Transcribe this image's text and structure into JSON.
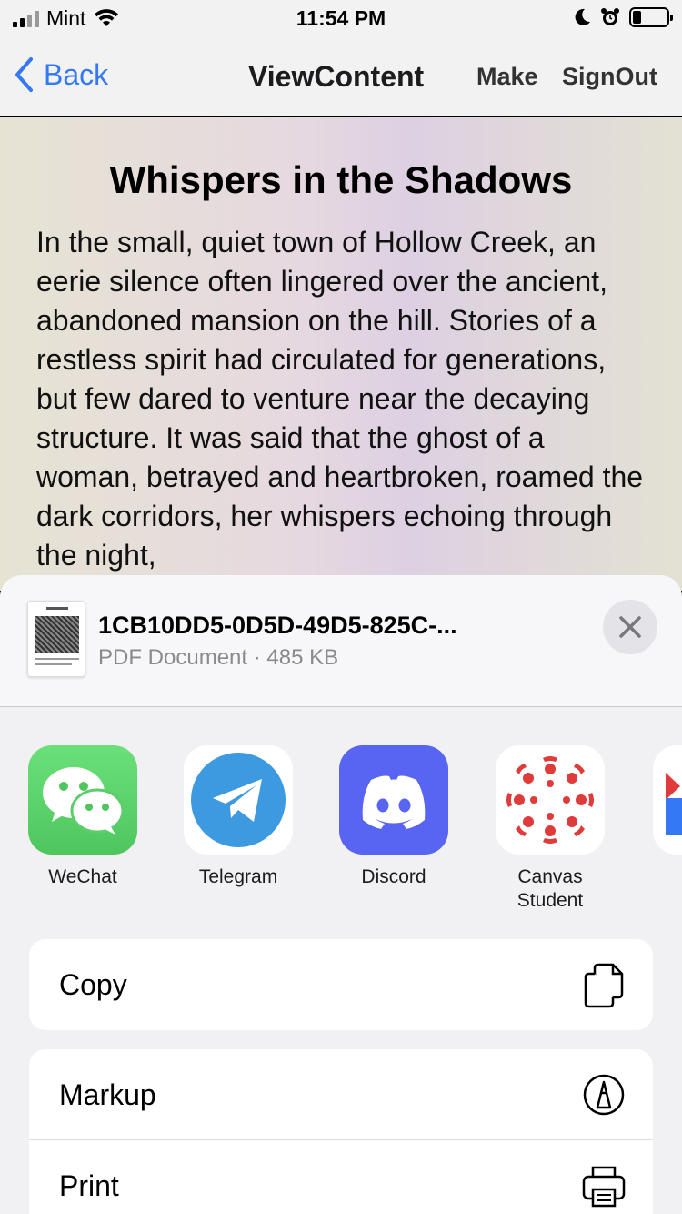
{
  "status_bar": {
    "carrier": "Mint",
    "time": "11:54 PM",
    "battery_level": 0.2
  },
  "nav": {
    "back_label": "Back",
    "title": "ViewContent",
    "make_label": "Make",
    "signout_label": "SignOut"
  },
  "document": {
    "title": "Whispers in the Shadows",
    "body": "In the small, quiet town of Hollow Creek, an eerie silence often lingered over the ancient, abandoned mansion on the hill. Stories of a restless spirit had circulated for generations, but few dared to venture near the decaying structure. It was said that the ghost of a woman, betrayed and heartbroken, roamed the dark corridors, her whispers echoing through the night,"
  },
  "share_sheet": {
    "file_name": "1CB10DD5-0D5D-49D5-825C-...",
    "file_meta": "PDF Document · 485 KB",
    "apps": [
      {
        "label": "WeChat",
        "icon": "wechat-icon",
        "color": "#5fcf6c"
      },
      {
        "label": "Telegram",
        "icon": "telegram-icon",
        "color": "#3d9ae0"
      },
      {
        "label": "Discord",
        "icon": "discord-icon",
        "color": "#5865f2"
      },
      {
        "label": "Canvas\nStudent",
        "icon": "canvas-student-icon",
        "color": "#e03b3b"
      }
    ],
    "actions": [
      {
        "label": "Copy",
        "icon": "copy-icon"
      },
      {
        "label": "Markup",
        "icon": "markup-icon"
      },
      {
        "label": "Print",
        "icon": "print-icon"
      }
    ]
  }
}
